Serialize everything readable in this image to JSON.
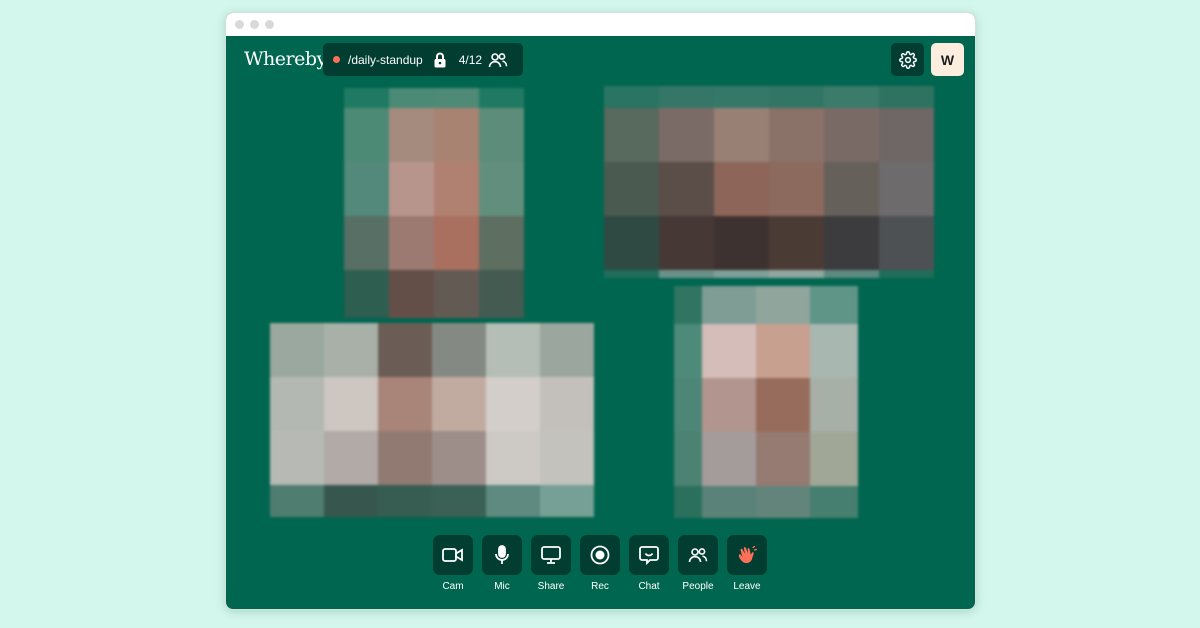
{
  "app": {
    "logo_text": "Whereby"
  },
  "room": {
    "name": "/daily-standup",
    "participants": "4/12",
    "live_color": "#ff7157"
  },
  "header": {
    "avatar_initial": "W"
  },
  "colors": {
    "background": "#d3f7ec",
    "window": "#006650",
    "button": "#013d31",
    "accent": "#ff7157",
    "avatar_bg": "#fbeedf"
  },
  "controls": [
    {
      "label": "Cam",
      "icon": "camera-icon"
    },
    {
      "label": "Mic",
      "icon": "mic-icon"
    },
    {
      "label": "Share",
      "icon": "screen-share-icon"
    },
    {
      "label": "Rec",
      "icon": "record-icon"
    },
    {
      "label": "Chat",
      "icon": "chat-icon"
    },
    {
      "label": "People",
      "icon": "people-icon"
    },
    {
      "label": "Leave",
      "icon": "wave-hand-icon"
    }
  ],
  "video_tiles": [
    {
      "name": "participant-1",
      "pixelated": true
    },
    {
      "name": "participant-2",
      "pixelated": true
    },
    {
      "name": "participant-3",
      "pixelated": true
    },
    {
      "name": "participant-4",
      "pixelated": true
    }
  ]
}
